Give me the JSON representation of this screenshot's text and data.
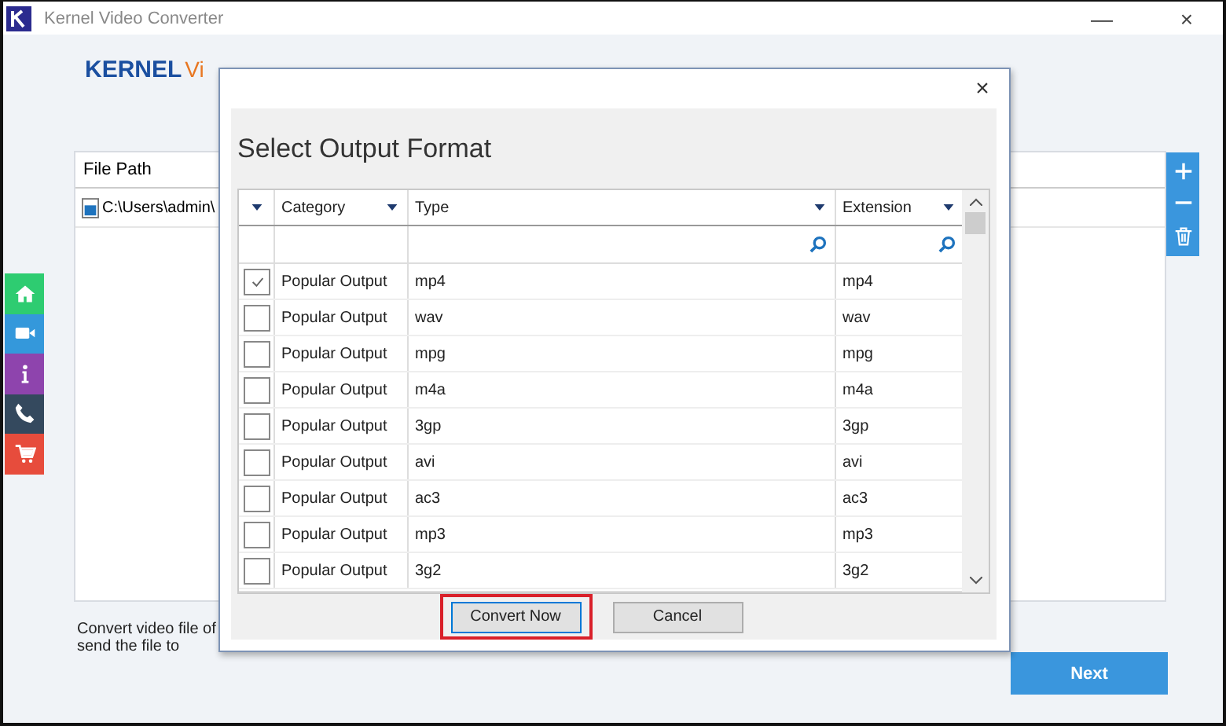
{
  "window": {
    "title": "Kernel Video Converter",
    "minimize": "—",
    "close": "×"
  },
  "logo": {
    "brand": "KERNEL",
    "product": "Vi"
  },
  "nav": [
    {
      "kind": "home",
      "color": "#2ecc71"
    },
    {
      "kind": "video",
      "color": "#3498db"
    },
    {
      "kind": "info",
      "color": "#8e44ad"
    },
    {
      "kind": "phone",
      "color": "#34495e"
    },
    {
      "kind": "cart",
      "color": "#e74c3c"
    }
  ],
  "file_panel": {
    "header": "File Path",
    "rows": [
      "C:\\Users\\admin\\"
    ]
  },
  "footer_text": [
    "Convert video file of",
    "send the file to"
  ],
  "next_button": "Next",
  "dialog": {
    "close": "×",
    "title": "Select Output Format",
    "columns": [
      "Category",
      "Type",
      "Extension"
    ],
    "rows": [
      {
        "checked": true,
        "category": "Popular Output",
        "type": "mp4",
        "extension": "mp4"
      },
      {
        "checked": false,
        "category": "Popular Output",
        "type": "wav",
        "extension": "wav"
      },
      {
        "checked": false,
        "category": "Popular Output",
        "type": "mpg",
        "extension": "mpg"
      },
      {
        "checked": false,
        "category": "Popular Output",
        "type": "m4a",
        "extension": "m4a"
      },
      {
        "checked": false,
        "category": "Popular Output",
        "type": "3gp",
        "extension": "3gp"
      },
      {
        "checked": false,
        "category": "Popular Output",
        "type": "avi",
        "extension": "avi"
      },
      {
        "checked": false,
        "category": "Popular Output",
        "type": "ac3",
        "extension": "ac3"
      },
      {
        "checked": false,
        "category": "Popular Output",
        "type": "mp3",
        "extension": "mp3"
      },
      {
        "checked": false,
        "category": "Popular Output",
        "type": "3g2",
        "extension": "3g2"
      }
    ],
    "buttons": [
      {
        "label": "Convert Now",
        "selected": true
      },
      {
        "label": "Cancel",
        "selected": false
      }
    ]
  }
}
